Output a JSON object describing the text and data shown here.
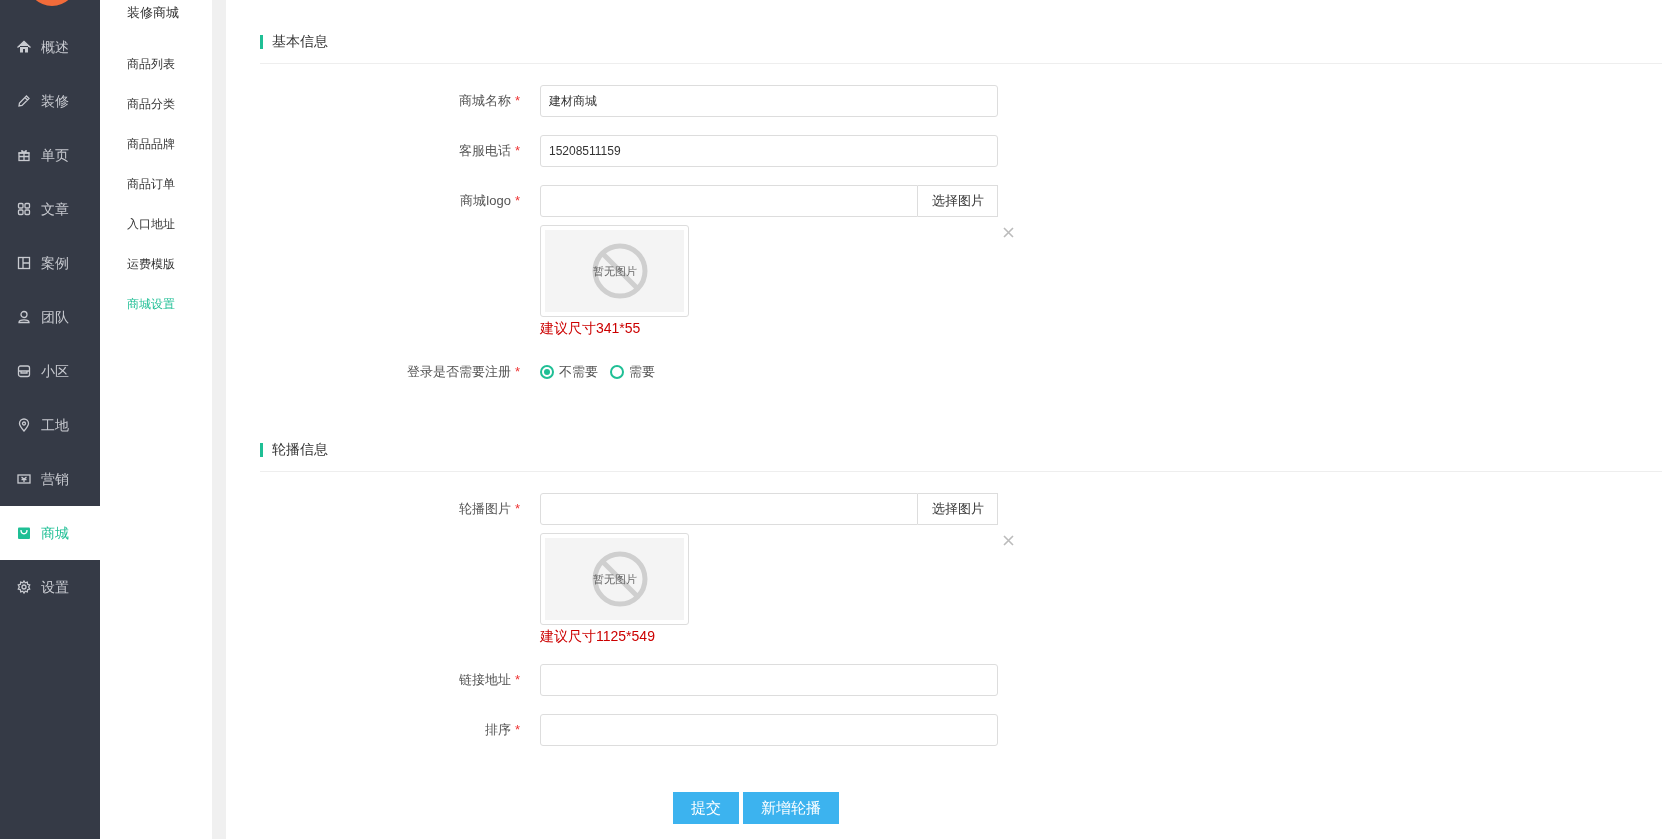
{
  "sidebar": {
    "items": [
      {
        "label": "概述",
        "selected": false
      },
      {
        "label": "装修",
        "selected": false
      },
      {
        "label": "单页",
        "selected": false
      },
      {
        "label": "文章",
        "selected": false
      },
      {
        "label": "案例",
        "selected": false
      },
      {
        "label": "团队",
        "selected": false
      },
      {
        "label": "小区",
        "selected": false
      },
      {
        "label": "工地",
        "selected": false
      },
      {
        "label": "营销",
        "selected": false
      },
      {
        "label": "商城",
        "selected": true
      },
      {
        "label": "设置",
        "selected": false
      }
    ]
  },
  "subnav": {
    "title": "装修商城",
    "items": [
      {
        "label": "商品列表",
        "selected": false
      },
      {
        "label": "商品分类",
        "selected": false
      },
      {
        "label": "商品品牌",
        "selected": false
      },
      {
        "label": "商品订单",
        "selected": false
      },
      {
        "label": "入口地址",
        "selected": false
      },
      {
        "label": "运费模版",
        "selected": false
      },
      {
        "label": "商城设置",
        "selected": true
      }
    ]
  },
  "sections": [
    {
      "title": "基本信息",
      "fields": [
        {
          "kind": "text",
          "label": "商城名称",
          "required_mark": "*",
          "value": "建材商城"
        },
        {
          "kind": "text",
          "label": "客服电话",
          "required_mark": "*",
          "value": "15208511159"
        },
        {
          "kind": "image",
          "label": "商城logo",
          "required_mark": "*",
          "button": "选择图片",
          "preview_text": "暂无图片",
          "hint": "建议尺寸341*55"
        },
        {
          "kind": "radio",
          "label": "登录是否需要注册",
          "required_mark": "*",
          "options": [
            {
              "label": "不需要",
              "selected": true
            },
            {
              "label": "需要",
              "selected": false
            }
          ]
        }
      ]
    },
    {
      "title": "轮播信息",
      "fields": [
        {
          "kind": "image",
          "label": "轮播图片",
          "required_mark": "*",
          "button": "选择图片",
          "preview_text": "暂无图片",
          "hint": "建议尺寸1125*549"
        },
        {
          "kind": "text",
          "label": "链接地址",
          "required_mark": "*"
        },
        {
          "kind": "text",
          "label": "排序",
          "required_mark": "*"
        }
      ]
    }
  ],
  "buttons": [
    "提交",
    "新增轮播"
  ]
}
